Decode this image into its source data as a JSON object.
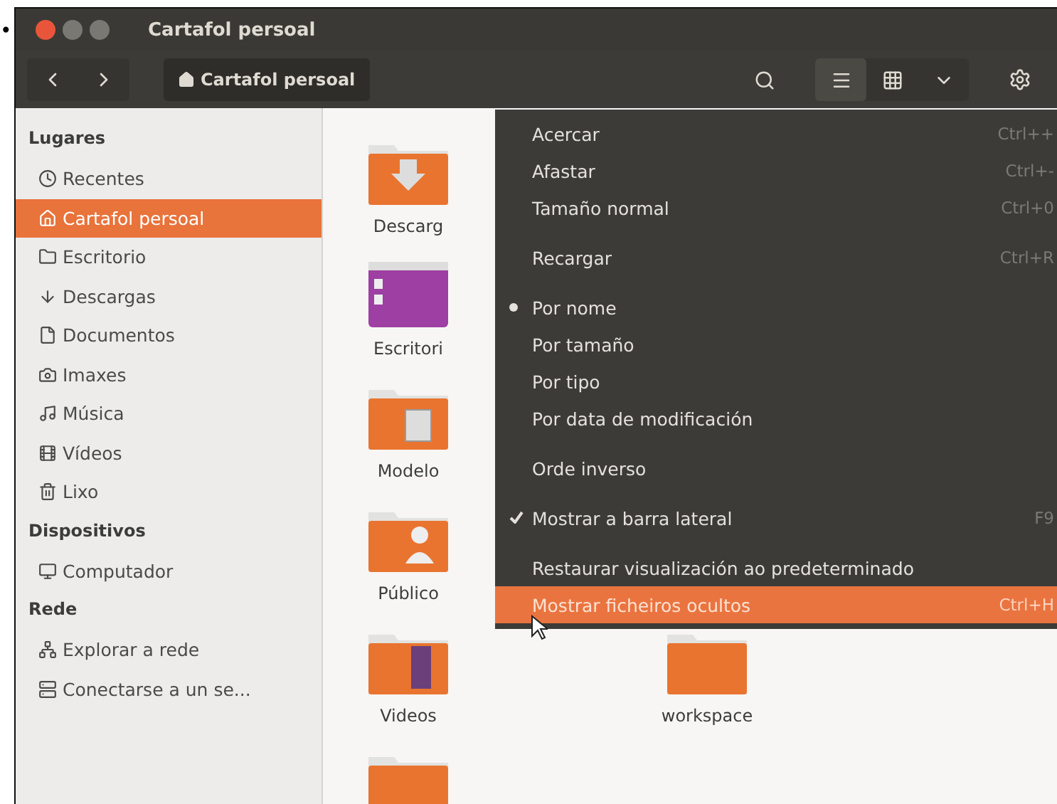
{
  "bullet": "•",
  "window": {
    "title": "Cartafol persoal"
  },
  "toolbar": {
    "location": "Cartafol persoal",
    "view_buttons": [
      {
        "selected": true
      },
      {
        "selected": false
      },
      {
        "selected": false
      }
    ]
  },
  "sidebar": {
    "sections": [
      {
        "heading": "Lugares",
        "items": [
          {
            "label": "Recentes",
            "selected": false
          },
          {
            "label": "Cartafol persoal",
            "selected": true
          },
          {
            "label": "Escritorio",
            "selected": false
          },
          {
            "label": "Descargas",
            "selected": false
          },
          {
            "label": "Documentos",
            "selected": false
          },
          {
            "label": "Imaxes",
            "selected": false
          },
          {
            "label": "Música",
            "selected": false
          },
          {
            "label": "Vídeos",
            "selected": false
          },
          {
            "label": "Lixo",
            "selected": false
          }
        ]
      },
      {
        "heading": "Dispositivos",
        "items": [
          {
            "label": "Computador",
            "selected": false
          }
        ]
      },
      {
        "heading": "Rede",
        "items": [
          {
            "label": "Explorar a rede",
            "selected": false
          },
          {
            "label": "Conectarse a un se...",
            "selected": false
          }
        ]
      }
    ]
  },
  "files": [
    {
      "label": "Descarg",
      "kind": "downloads"
    },
    {
      "label": "Escritori",
      "kind": "desktop"
    },
    {
      "label": "Modelo",
      "kind": "templates"
    },
    {
      "label": "Público",
      "kind": "public"
    },
    {
      "label": "Videos",
      "kind": "videos"
    },
    {
      "label": "workspace",
      "kind": "folder"
    },
    {
      "kind": "folder"
    }
  ],
  "menu": {
    "items": [
      {
        "kind": "action",
        "label": "Acercar",
        "shortcut": "Ctrl++",
        "highlighted": false
      },
      {
        "kind": "action",
        "label": "Afastar",
        "shortcut": "Ctrl+-",
        "highlighted": false
      },
      {
        "kind": "action",
        "label": "Tamaño normal",
        "shortcut": "Ctrl+0",
        "highlighted": false
      },
      {
        "kind": "separator"
      },
      {
        "kind": "action",
        "label": "Recargar",
        "shortcut": "Ctrl+R",
        "highlighted": false
      },
      {
        "kind": "separator"
      },
      {
        "kind": "radio",
        "label": "Por nome",
        "selected": true,
        "highlighted": false
      },
      {
        "kind": "radio",
        "label": "Por tamaño",
        "selected": false,
        "highlighted": false
      },
      {
        "kind": "radio",
        "label": "Por tipo",
        "selected": false,
        "highlighted": false
      },
      {
        "kind": "radio",
        "label": "Por data de modificación",
        "selected": false,
        "highlighted": false
      },
      {
        "kind": "separator"
      },
      {
        "kind": "check",
        "label": "Orde inverso",
        "checked": false,
        "highlighted": false
      },
      {
        "kind": "separator"
      },
      {
        "kind": "check",
        "label": "Mostrar a barra lateral",
        "shortcut": "F9",
        "checked": true,
        "highlighted": false
      },
      {
        "kind": "separator"
      },
      {
        "kind": "action",
        "label": "Restaurar visualización ao predeterminado",
        "highlighted": false
      },
      {
        "kind": "action",
        "label": "Mostrar ficheiros ocultos",
        "shortcut": "Ctrl+H",
        "highlighted": true
      }
    ]
  }
}
